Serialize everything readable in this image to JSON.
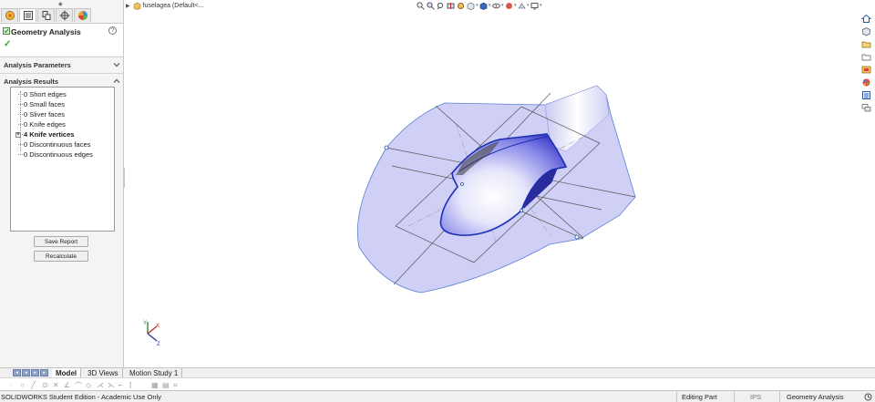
{
  "panel": {
    "title": "Geometry Analysis",
    "help": "?",
    "ok": "✓",
    "tabs": [
      "feature-manager-icon",
      "property-manager-icon",
      "configuration-manager-icon",
      "dimxpert-icon",
      "display-manager-icon"
    ],
    "parameters_section": "Analysis Parameters",
    "results_section": "Analysis Results",
    "results": [
      {
        "label": "0 Short edges",
        "bold": false
      },
      {
        "label": "0 Small faces",
        "bold": false
      },
      {
        "label": "0 Sliver faces",
        "bold": false
      },
      {
        "label": "0 Knife edges",
        "bold": false
      },
      {
        "label": "4 Knife vertices",
        "bold": true
      },
      {
        "label": "0 Discontinuous faces",
        "bold": false
      },
      {
        "label": "0 Discontinuous edges",
        "bold": false
      }
    ],
    "expander": "+",
    "save_report": "Save Report",
    "recalculate": "Recalculate",
    "splitter": "‹"
  },
  "graphics": {
    "flyout_label": "fuselagea  (Default<...",
    "hud_icons": [
      "zoom-to-fit-icon",
      "zoom-area-icon",
      "previous-view-icon",
      "section-view-icon",
      "dynamic-annotation-icon",
      "view-orientation-icon",
      "display-style-icon",
      "hide-show-icon",
      "edit-appearance-icon",
      "apply-scene-icon",
      "view-settings-icon"
    ],
    "task_icons": [
      "home-icon",
      "3d-content-icon",
      "design-library-icon",
      "file-explorer-icon",
      "appearances-icon",
      "custom-properties-icon",
      "forum-icon"
    ],
    "colors": {
      "surface_fill": "#c8c8f5",
      "surface_edge": "#5a82d2",
      "fuselage_edge": "#1a2fb4",
      "sketch_lines": "#555555"
    }
  },
  "bottom_tabs": {
    "tabs": [
      "Model",
      "3D Views",
      "Motion Study 1"
    ],
    "active": "Model"
  },
  "status": {
    "left": "SOLIDWORKS Student Edition - Academic Use Only",
    "mode": "Editing Part",
    "units": "IPS",
    "tool": "Geometry Analysis"
  }
}
